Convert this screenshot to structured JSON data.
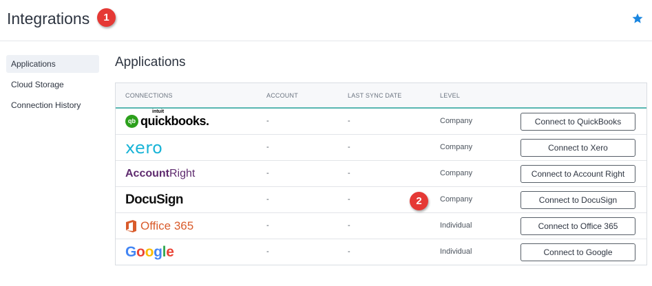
{
  "header": {
    "title": "Integrations",
    "badge_1": "1",
    "star_icon": "star-icon",
    "star_color": "#1a86e0"
  },
  "sidebar": {
    "items": [
      {
        "label": "Applications",
        "active": true
      },
      {
        "label": "Cloud Storage",
        "active": false
      },
      {
        "label": "Connection History",
        "active": false
      }
    ]
  },
  "main": {
    "section_title": "Applications",
    "columns": [
      "CONNECTIONS",
      "ACCOUNT",
      "LAST SYNC DATE",
      "LEVEL"
    ],
    "rows": [
      {
        "logo": "quickbooks-logo",
        "logo_text": "quickbooks.",
        "logo_sub": "intuit",
        "account": "-",
        "last_sync": "-",
        "level": "Company",
        "button": "Connect to QuickBooks"
      },
      {
        "logo": "xero-logo",
        "logo_text": "xero",
        "account": "-",
        "last_sync": "-",
        "level": "Company",
        "button": "Connect to Xero"
      },
      {
        "logo": "accountright-logo",
        "logo_text_a": "Account",
        "logo_text_b": "Right",
        "account": "-",
        "last_sync": "-",
        "level": "Company",
        "button": "Connect to Account Right"
      },
      {
        "logo": "docusign-logo",
        "logo_text": "DocuSign",
        "account": "-",
        "last_sync": "-",
        "level": "Company",
        "button": "Connect to DocuSign"
      },
      {
        "logo": "office365-logo",
        "logo_text": "Office 365",
        "account": "-",
        "last_sync": "-",
        "level": "Individual",
        "button": "Connect to Office 365"
      },
      {
        "logo": "google-logo",
        "logo_text": "Google",
        "account": "-",
        "last_sync": "-",
        "level": "Individual",
        "button": "Connect to Google"
      }
    ],
    "badge_2": "2"
  },
  "colors": {
    "accent_teal": "#57b6b0",
    "badge_red": "#e53935",
    "qb_green": "#2ca01c",
    "xero_blue": "#1ab4d7",
    "ar_purple": "#5e2a6e",
    "o365_orange": "#d95b2b"
  }
}
